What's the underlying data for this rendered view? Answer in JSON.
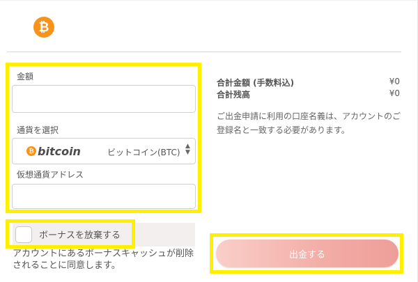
{
  "brand": {
    "logo_glyph": "₿",
    "logo_color": "#f7931a"
  },
  "form": {
    "amount_label": "金額",
    "amount_value": "",
    "currency_label": "通貨を選択",
    "currency_brand_glyph": "₿",
    "currency_brand_word": "bitcoin",
    "currency_selected": "ビットコイン(BTC)",
    "address_label": "仮想通貨アドレス",
    "address_value": ""
  },
  "bonus": {
    "checkbox_label": "ボーナスを放棄する",
    "checked": false,
    "note": "アカウントにあるボーナスキャッシュが削除されることに同意します。"
  },
  "summary": {
    "total_label": "合計金額 (手数料込)",
    "total_value": "¥0",
    "balance_label": "合計残高",
    "balance_value": "¥0",
    "notice": "ご出金申請に利用の口座名義は、アカウントのご登録名と一致する必要があります。"
  },
  "actions": {
    "withdraw_label": "出金する"
  },
  "colors": {
    "highlight": "#ffef00",
    "button_start": "#f9cfc8",
    "button_end": "#ee9e99",
    "bitcoin_orange": "#f7931a"
  }
}
